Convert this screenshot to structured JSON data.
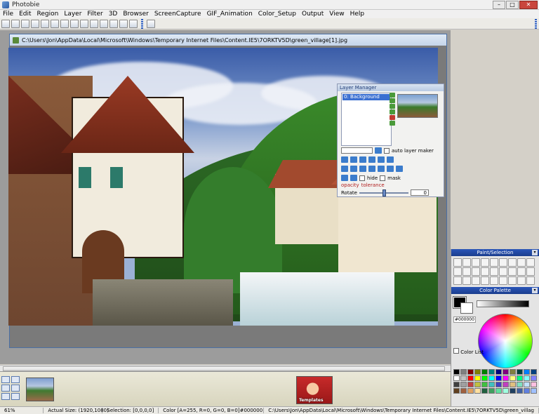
{
  "window": {
    "title": "Photobie"
  },
  "menu": [
    "File",
    "Edit",
    "Region",
    "Layer",
    "Filter",
    "3D",
    "Browser",
    "ScreenCapture",
    "GIF_Animation",
    "Color_Setup",
    "Output",
    "View",
    "Help"
  ],
  "document": {
    "path": "C:\\Users\\Jon\\AppData\\Local\\Microsoft\\Windows\\Temporary Internet Files\\Content.IE5\\7ORKTV5D\\green_village[1].jpg"
  },
  "layer_manager": {
    "title": "Layer Manager",
    "layers": [
      "0: Background"
    ],
    "auto_layer_label": "auto layer maker",
    "hide_label": "hide",
    "mask_label": "mask",
    "opacity_label": "opacity",
    "tolerance_label": "tolerance",
    "rotate_label": "Rotate",
    "rotate_value": "0"
  },
  "paint_panel": {
    "title": "Paint/Selection"
  },
  "color_panel": {
    "title": "Color Palette",
    "hex": "#000000",
    "list_label": "Color List"
  },
  "filmstrip": {
    "thumb2_label": "Templates"
  },
  "status": {
    "zoom": "61%",
    "actual_size": "Actual Size: (1920,1080)",
    "selection": "Selection: [0,0,0,0]",
    "color": "Color [A=255, R=0, G=0, B=0]#000000",
    "path": "C:\\Users\\Jon\\AppData\\Local\\Microsoft\\Windows\\Temporary Internet Files\\Content.IE5\\7ORKTV5D\\green_villag"
  },
  "palette_colors": [
    "#000000",
    "#808080",
    "#800000",
    "#808000",
    "#008000",
    "#008080",
    "#000080",
    "#800080",
    "#808040",
    "#004040",
    "#0080ff",
    "#004080",
    "#ffffff",
    "#c0c0c0",
    "#ff0000",
    "#ffff00",
    "#00ff00",
    "#00ffff",
    "#0000ff",
    "#ff00ff",
    "#ffff80",
    "#00ff80",
    "#80ffff",
    "#8080ff",
    "#404040",
    "#a0a0a0",
    "#c04040",
    "#c0c040",
    "#40c040",
    "#40c0c0",
    "#4040c0",
    "#c040c0",
    "#e0c080",
    "#80e0c0",
    "#c0e0ff",
    "#ffc0e0",
    "#604020",
    "#a06040",
    "#e0a060",
    "#ffe0a0",
    "#206040",
    "#40a060",
    "#60e0a0",
    "#a0ffe0",
    "#204060",
    "#4060a0",
    "#6080e0",
    "#a0c0ff"
  ]
}
